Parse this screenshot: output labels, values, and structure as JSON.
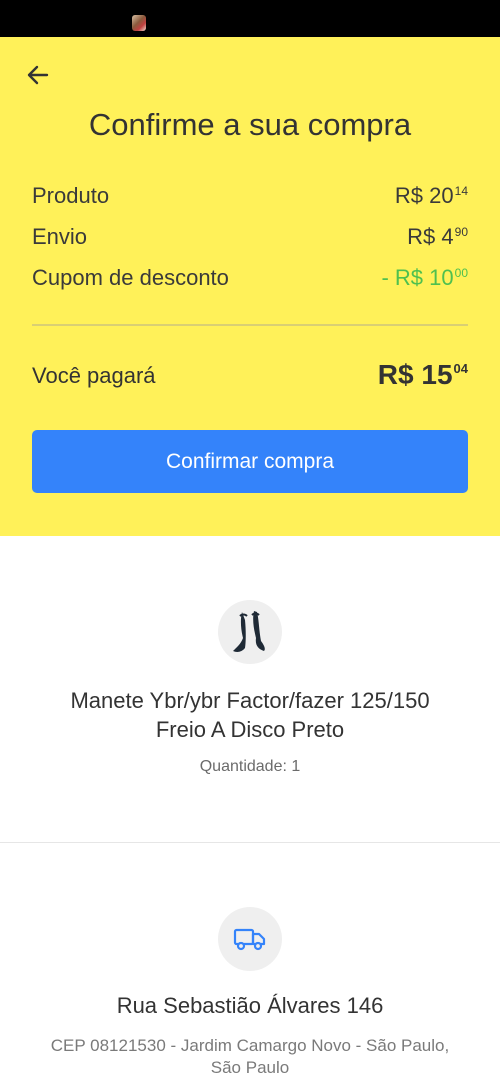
{
  "header": {
    "title": "Confirme a sua compra"
  },
  "summary": {
    "rows": [
      {
        "label": "Produto",
        "prefix": "",
        "currency": "R$",
        "integer": "20",
        "cents": "14"
      },
      {
        "label": "Envio",
        "prefix": "",
        "currency": "R$",
        "integer": "4",
        "cents": "90"
      },
      {
        "label": "Cupom de desconto",
        "prefix": "-",
        "currency": "R$",
        "integer": "10",
        "cents": "00"
      }
    ],
    "total": {
      "label": "Você pagará",
      "currency": "R$",
      "integer": "15",
      "cents": "04"
    },
    "confirm_label": "Confirmar compra"
  },
  "product": {
    "icon": "motorcycle-lever-product-image",
    "name_line1": "Manete Ybr/ybr Factor/fazer 125/150",
    "name_line2": "Freio A Disco Preto",
    "quantity": "Quantidade: 1"
  },
  "shipping": {
    "icon": "truck-icon",
    "street": "Rua Sebastião Álvares 146",
    "detail_line1": "CEP 08121530 - Jardim Camargo Novo - São Paulo,",
    "detail_line2": "São Paulo"
  },
  "colors": {
    "header_background": "#fff159",
    "primary_button": "#3483fa",
    "discount_text": "#4fc04f",
    "icon_circle": "#efefef"
  }
}
